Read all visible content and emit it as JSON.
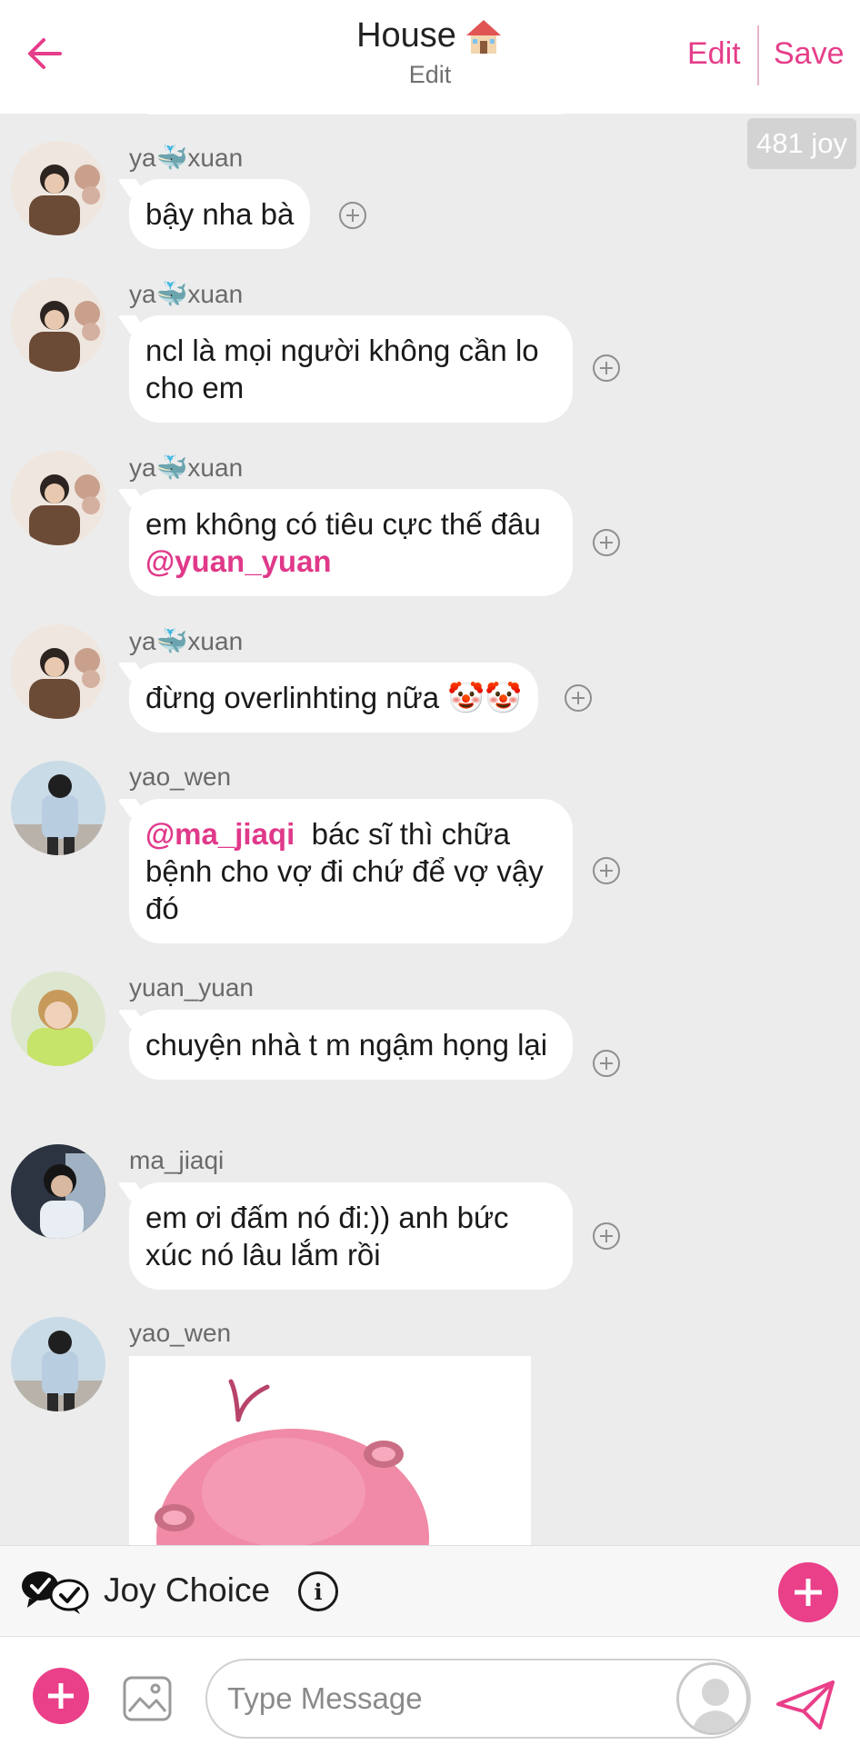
{
  "header": {
    "title": "House",
    "title_icon": "house-emoji",
    "subtitle": "Edit",
    "edit_label": "Edit",
    "save_label": "Save",
    "accent_color": "#e53e8a"
  },
  "joy_badge": "481 joy",
  "messages": [
    {
      "username": "ya🐳xuan",
      "text": "bậy nha bà"
    },
    {
      "username": "ya🐳xuan",
      "text": "ncl là mọi người không cần lo cho em"
    },
    {
      "username": "ya🐳xuan",
      "text": "em không có tiêu cực thế đâu",
      "mention": "@yuan_yuan"
    },
    {
      "username": "ya🐳xuan",
      "text": "đừng overlinhting nữa 🤡🤡"
    },
    {
      "username": "yao_wen",
      "mention": "@ma_jiaqi",
      "text": "bác sĩ thì chữa bệnh cho vợ đi chứ để vợ vậy đó"
    },
    {
      "username": "yuan_yuan",
      "text": "chuyện nhà t m ngậm họng lại"
    },
    {
      "username": "ma_jiaqi",
      "text": "em ơi đấm nó đi:)) anh bức xúc nó lâu lắm rồi"
    },
    {
      "username": "yao_wen",
      "image": "pink-creature-sticker"
    }
  ],
  "joy_choice": {
    "label": "Joy Choice",
    "icon": "chat-check-icon"
  },
  "composer": {
    "placeholder": "Type Message"
  }
}
